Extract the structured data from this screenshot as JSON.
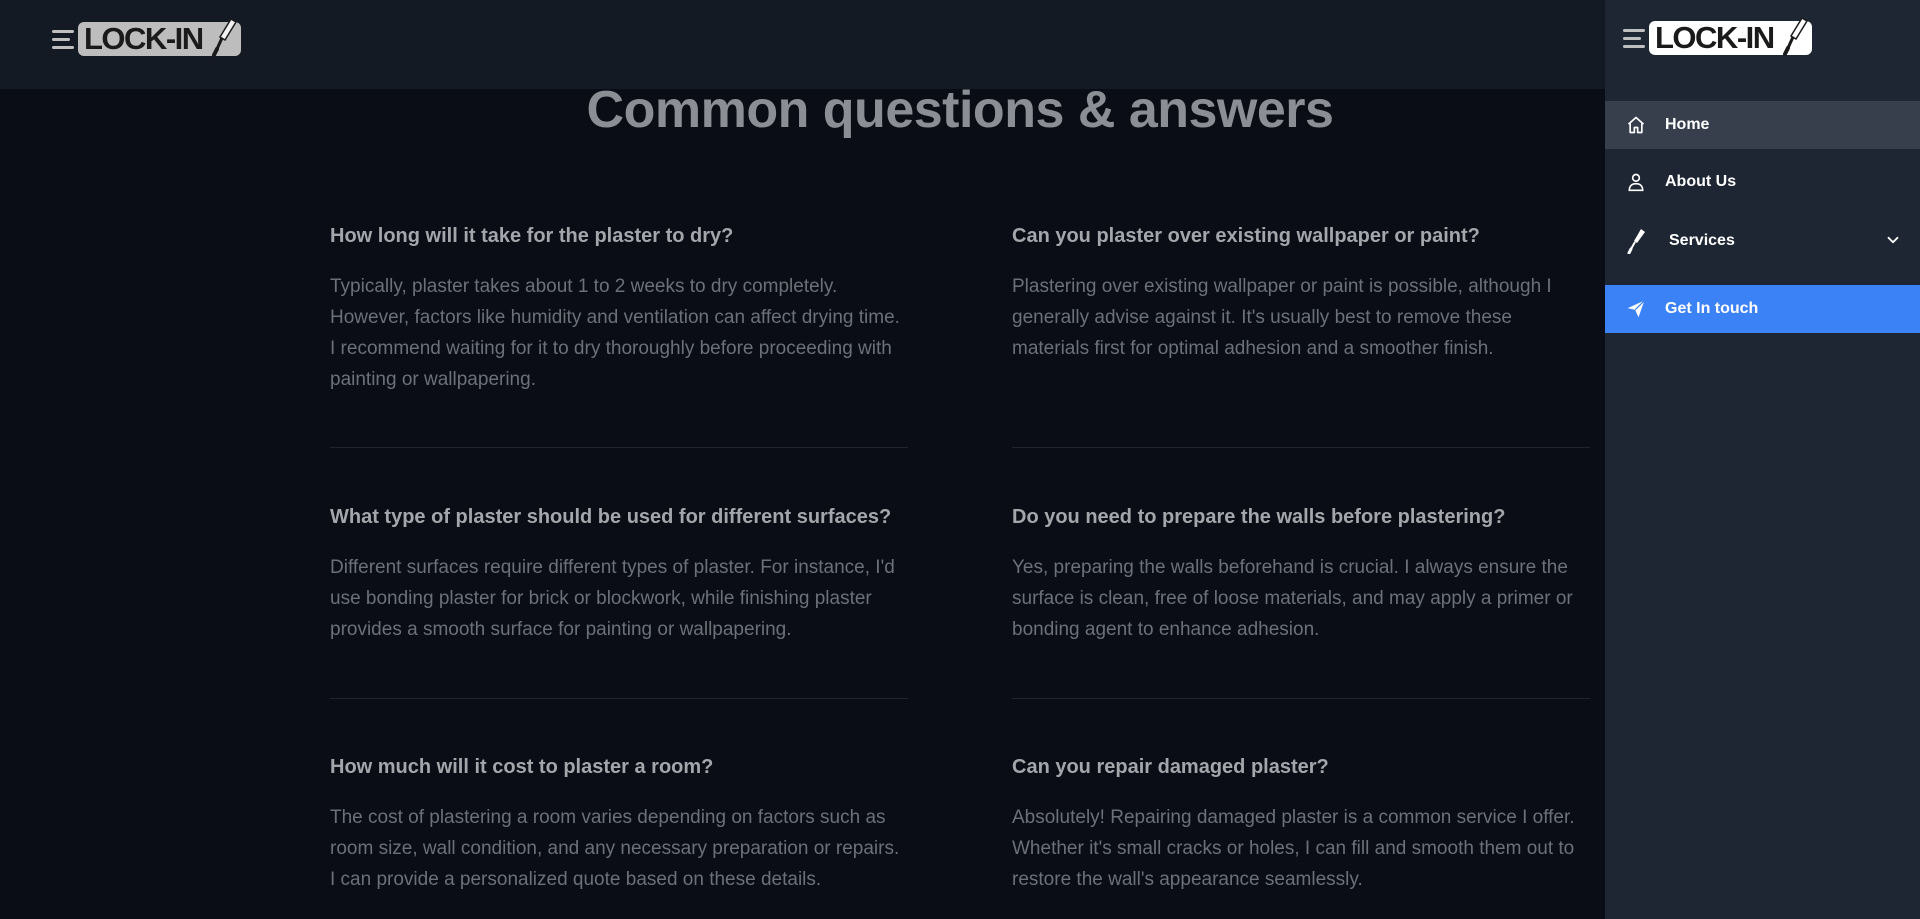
{
  "brand": {
    "logo_text": "LOCK-IN"
  },
  "faq": {
    "title": "Common questions & answers",
    "items": [
      {
        "question": "How long will it take for the plaster to dry?",
        "answer": "Typically, plaster takes about 1 to 2 weeks to dry completely. However, factors like humidity and ventilation can affect drying time. I recommend waiting for it to dry thoroughly before proceeding with painting or wallpapering."
      },
      {
        "question": "Can you plaster over existing wallpaper or paint?",
        "answer": "Plastering over existing wallpaper or paint is possible, although I generally advise against it. It's usually best to remove these materials first for optimal adhesion and a smoother finish."
      },
      {
        "question": "What type of plaster should be used for different surfaces?",
        "answer": "Different surfaces require different types of plaster. For instance, I'd use bonding plaster for brick or blockwork, while finishing plaster provides a smooth surface for painting or wallpapering."
      },
      {
        "question": "Do you need to prepare the walls before plastering?",
        "answer": "Yes, preparing the walls beforehand is crucial. I always ensure the surface is clean, free of loose materials, and may apply a primer or bonding agent to enhance adhesion."
      },
      {
        "question": "How much will it cost to plaster a room?",
        "answer": "The cost of plastering a room varies depending on factors such as room size, wall condition, and any necessary preparation or repairs. I can provide a personalized quote based on these details."
      },
      {
        "question": "Can you repair damaged plaster?",
        "answer": "Absolutely! Repairing damaged plaster is a common service I offer. Whether it's small cracks or holes, I can fill and smooth them out to restore the wall's appearance seamlessly."
      }
    ]
  },
  "drawer": {
    "nav": [
      {
        "label": "Home",
        "icon": "home-icon",
        "state": "active"
      },
      {
        "label": "About Us",
        "icon": "user-icon"
      },
      {
        "label": "Services",
        "icon": "trowel-icon",
        "has_submenu": true
      },
      {
        "label": "Get In touch",
        "icon": "send-icon",
        "state": "call-to-action"
      }
    ],
    "colors": {
      "drawer_bg": "#1e2633",
      "active_bg": "#373f4d",
      "cta_bg": "#3b82f6"
    }
  }
}
